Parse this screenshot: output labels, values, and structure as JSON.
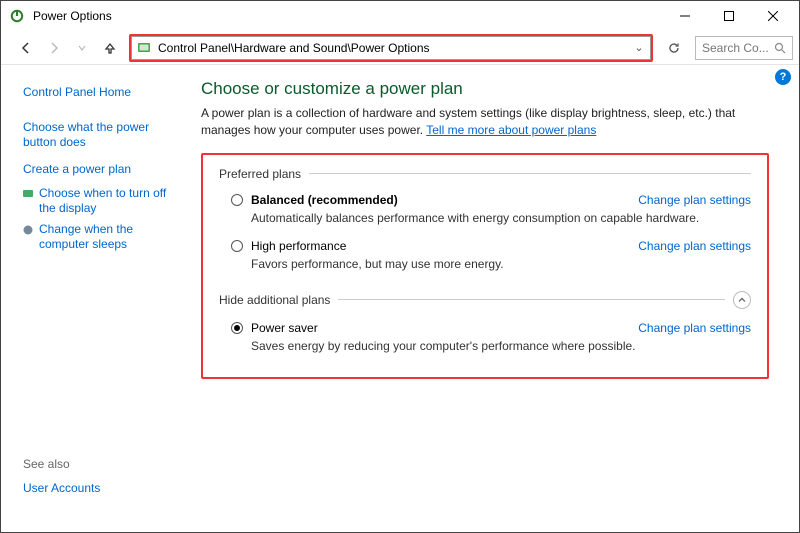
{
  "window": {
    "title": "Power Options"
  },
  "address_bar": {
    "path": "Control Panel\\Hardware and Sound\\Power Options"
  },
  "search": {
    "placeholder": "Search Co..."
  },
  "sidebar": {
    "items": [
      {
        "label": "Control Panel Home"
      },
      {
        "label": "Choose what the power button does"
      },
      {
        "label": "Create a power plan"
      },
      {
        "label": "Choose when to turn off the display"
      },
      {
        "label": "Change when the computer sleeps"
      }
    ],
    "see_also_label": "See also",
    "see_also_items": [
      {
        "label": "User Accounts"
      }
    ]
  },
  "main": {
    "heading": "Choose or customize a power plan",
    "description_prefix": "A power plan is a collection of hardware and system settings (like display brightness, sleep, etc.) that manages how your computer uses power. ",
    "description_link": "Tell me more about power plans",
    "group_preferred": "Preferred plans",
    "group_additional": "Hide additional plans",
    "change_link": "Change plan settings",
    "plans": [
      {
        "name": "Balanced (recommended)",
        "desc": "Automatically balances performance with energy consumption on capable hardware.",
        "selected": false,
        "bold": true
      },
      {
        "name": "High performance",
        "desc": "Favors performance, but may use more energy.",
        "selected": false,
        "bold": false
      },
      {
        "name": "Power saver",
        "desc": "Saves energy by reducing your computer's performance where possible.",
        "selected": true,
        "bold": false
      }
    ]
  }
}
